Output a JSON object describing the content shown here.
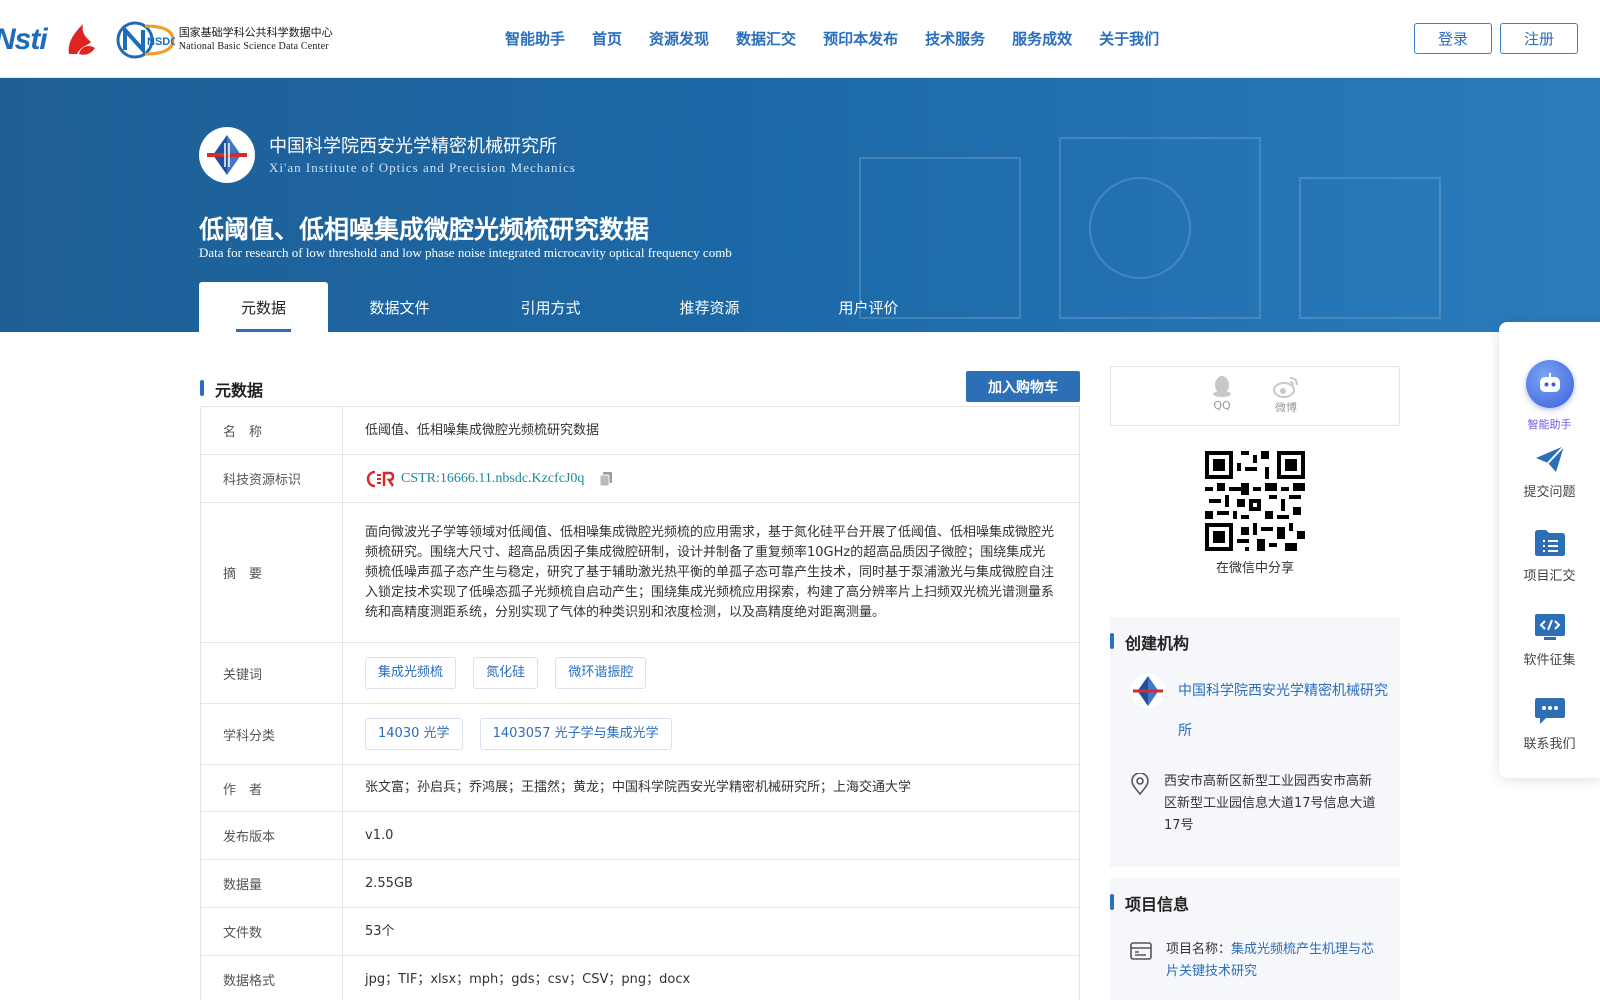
{
  "header": {
    "logos": {
      "nsti_text": "Nsti",
      "nsdc_badge": "NSDC",
      "nsdc_cn": "国家基础学科公共科学数据中心",
      "nsdc_en": "National Basic Science Data Center"
    },
    "nav": [
      "智能助手",
      "首页",
      "资源发现",
      "数据汇交",
      "预印本发布",
      "技术服务",
      "服务成效",
      "关于我们"
    ],
    "login": "登录",
    "register": "注册"
  },
  "banner": {
    "institution_cn": "中国科学院西安光学精密机械研究所",
    "institution_en": "Xi'an Institute of Optics and Precision Mechanics",
    "title_cn": "低阈值、低相噪集成微腔光频梳研究数据",
    "title_en": "Data for research of low threshold and low phase noise integrated microcavity optical frequency comb",
    "tabs": [
      "元数据",
      "数据文件",
      "引用方式",
      "推荐资源",
      "用户评价"
    ]
  },
  "metadata": {
    "section_title": "元数据",
    "cart_button": "加入购物车",
    "rows": {
      "name": {
        "label": "名　称",
        "value": "低阈值、低相噪集成微腔光频梳研究数据"
      },
      "cstr": {
        "label": "科技资源标识",
        "value": "CSTR:16666.11.nbsdc.KzcfcJ0q"
      },
      "abstract": {
        "label": "摘　要",
        "value": "面向微波光子学等领域对低阈值、低相噪集成微腔光频梳的应用需求，基于氮化硅平台开展了低阈值、低相噪集成微腔光频梳研究。围绕大尺寸、超高品质因子集成微腔研制，设计并制备了重复频率10GHz的超高品质因子微腔；围绕集成光频梳低噪声孤子态产生与稳定，研究了基于辅助激光热平衡的单孤子态可靠产生技术，同时基于泵浦激光与集成微腔自注入锁定技术实现了低噪态孤子光频梳自启动产生；围绕集成光频梳应用探索，构建了高分辨率片上扫频双光梳光谱测量系统和高精度测距系统，分别实现了气体的种类识别和浓度检测，以及高精度绝对距离测量。"
      },
      "keywords": {
        "label": "关键词",
        "values": [
          "集成光频梳",
          "氮化硅",
          "微环谐振腔"
        ]
      },
      "subjects": {
        "label": "学科分类",
        "values": [
          "14030 光学",
          "1403057 光子学与集成光学"
        ]
      },
      "authors": {
        "label": "作　者",
        "value": "张文富；孙启兵；乔鸿展；王擂然；黄龙；中国科学院西安光学精密机械研究所；上海交通大学"
      },
      "version": {
        "label": "发布版本",
        "value": "v1.0"
      },
      "size": {
        "label": "数据量",
        "value": "2.55GB"
      },
      "files": {
        "label": "文件数",
        "value": "53个"
      },
      "formats": {
        "label": "数据格式",
        "value": "jpg；TIF；xlsx；mph；gds；csv；CSV；png；docx"
      }
    }
  },
  "share": {
    "qq": "QQ",
    "weibo": "微博",
    "wechat_caption": "在微信中分享"
  },
  "creator": {
    "section_title": "创建机构",
    "org_name": "中国科学院西安光学精密机械研究所",
    "address": "西安市高新区新型工业园西安市高新区新型工业园信息大道17号信息大道17号"
  },
  "project": {
    "section_title": "项目信息",
    "name_label": "项目名称：",
    "name_value": "集成光频梳产生机理与芯片关键技术研究"
  },
  "float_bar": {
    "items": [
      "智能助手",
      "提交问题",
      "项目汇交",
      "软件征集",
      "联系我们"
    ]
  },
  "colors": {
    "brand_blue": "#2a6ebc",
    "banner_blue": "#1c68a6",
    "cstr_teal": "#1a8a9a"
  }
}
